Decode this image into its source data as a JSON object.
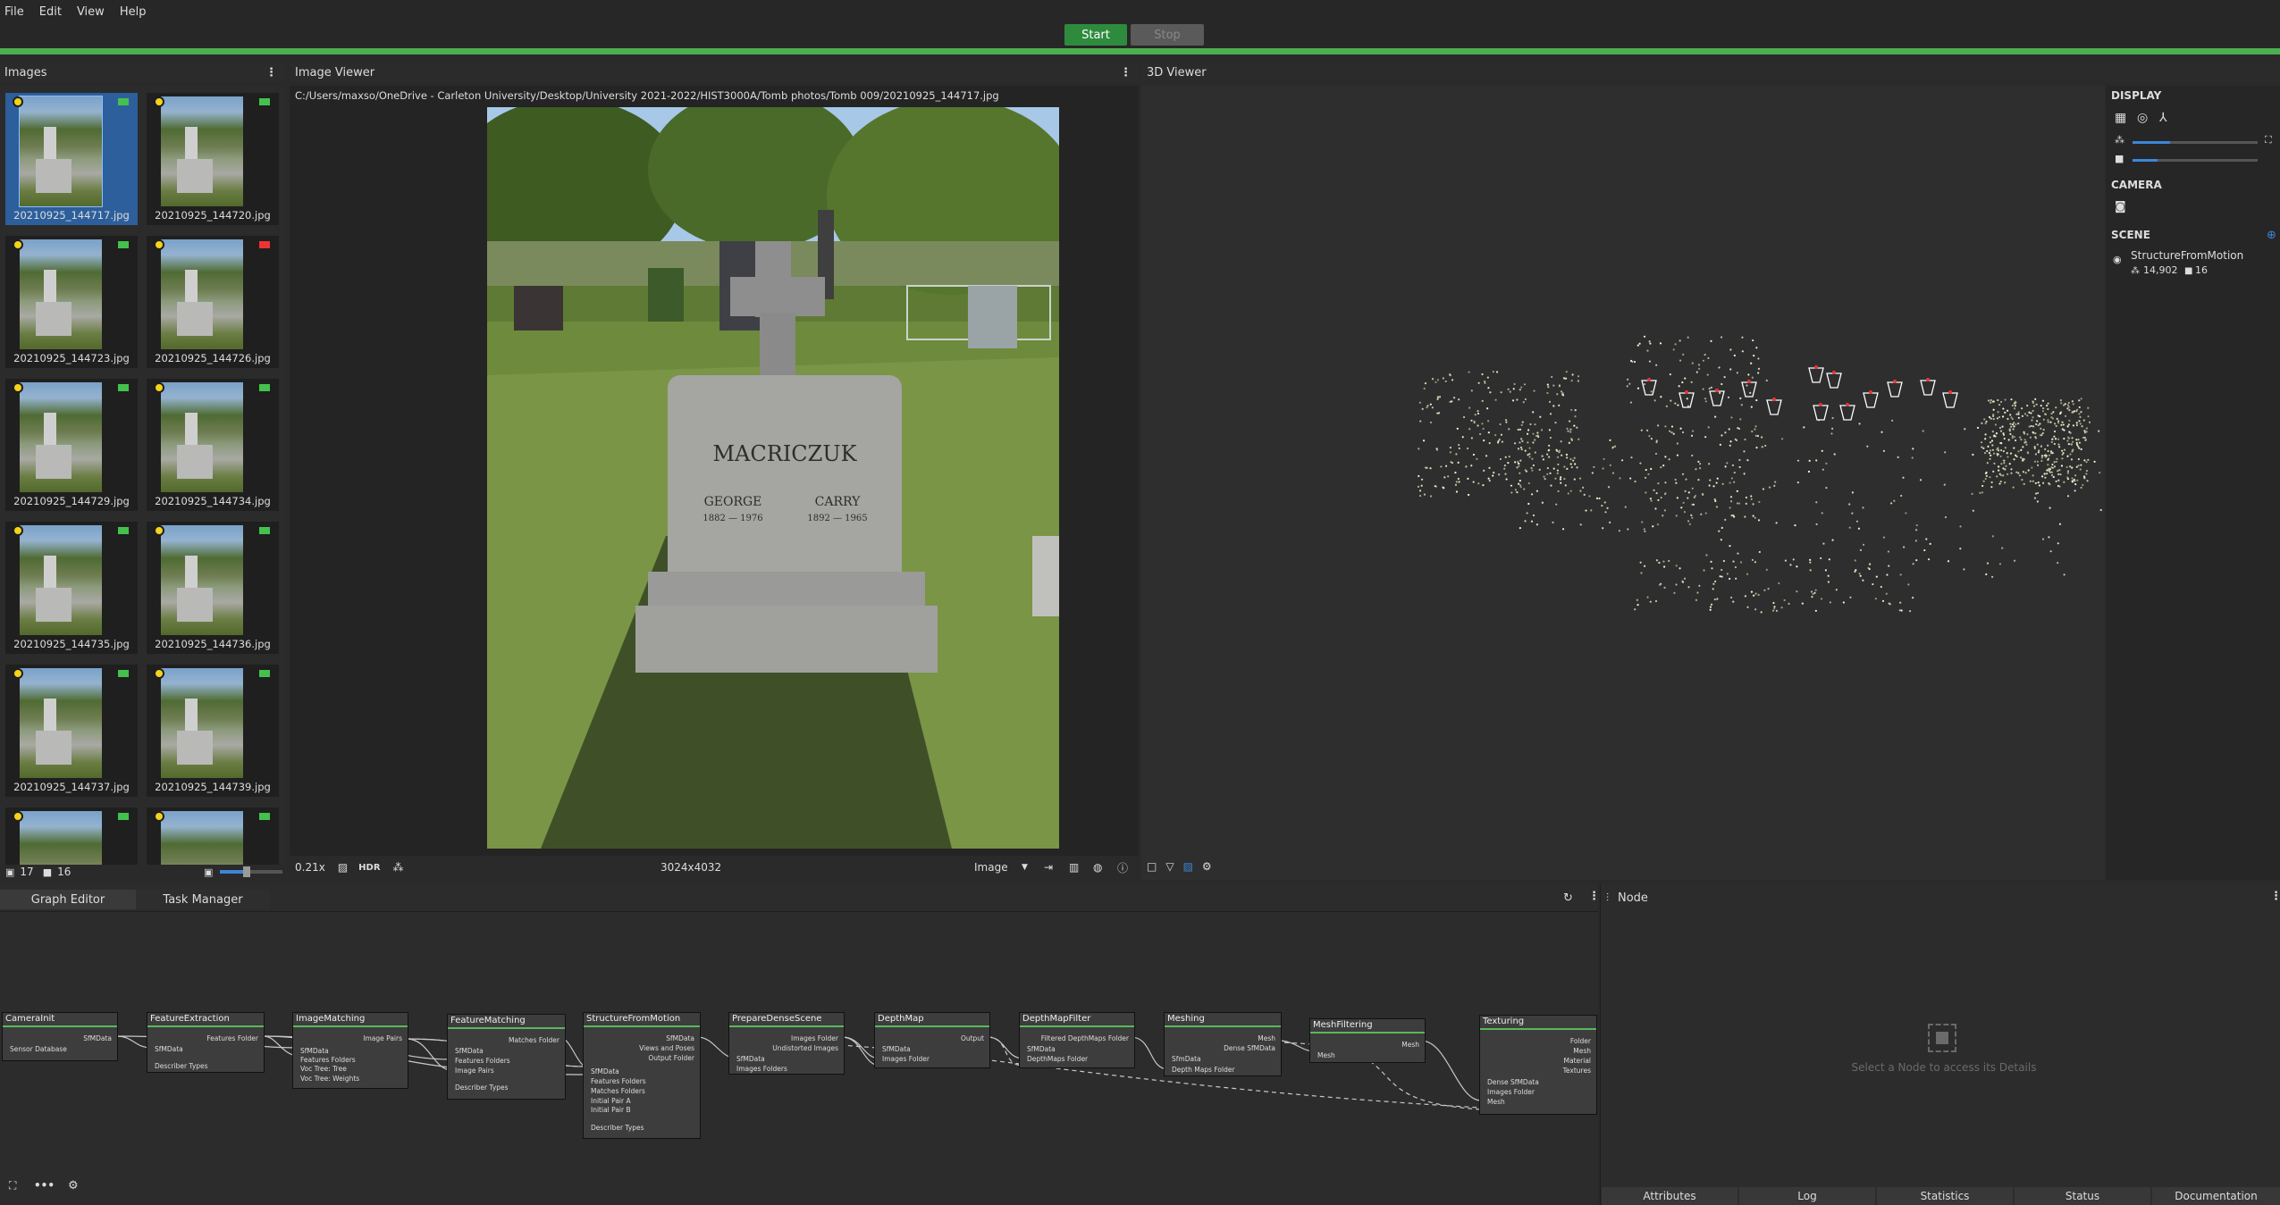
{
  "menu": {
    "file": "File",
    "edit": "Edit",
    "view": "View",
    "help": "Help"
  },
  "toolbar": {
    "start": "Start",
    "stop": "Stop"
  },
  "images_panel": {
    "title": "Images",
    "thumbs": [
      {
        "label": "20210925_144717.jpg"
      },
      {
        "label": "20210925_144720.jpg"
      },
      {
        "label": "20210925_144723.jpg"
      },
      {
        "label": "20210925_144726.jpg"
      },
      {
        "label": "20210925_144729.jpg"
      },
      {
        "label": "20210925_144734.jpg"
      },
      {
        "label": "20210925_144735.jpg"
      },
      {
        "label": "20210925_144736.jpg"
      },
      {
        "label": "20210925_144737.jpg"
      },
      {
        "label": "20210925_144739.jpg"
      },
      {
        "label": ""
      },
      {
        "label": ""
      }
    ],
    "image_count": "17",
    "camera_count": "16"
  },
  "image_viewer": {
    "title": "Image Viewer",
    "path": "C:/Users/maxso/OneDrive - Carleton University/Desktop/University 2021-2022/HIST3000A/Tomb photos/Tomb 009/20210925_144717.jpg",
    "zoom": "0.21x",
    "hdr": "HDR",
    "resolution": "3024x4032",
    "mode": "Image",
    "tomb_text": "MACRICZUK",
    "name_left": "GEORGE",
    "years_left": "1882 — 1976",
    "name_right": "CARRY",
    "years_right": "1892 — 1965"
  },
  "viewer3d": {
    "title": "3D Viewer",
    "display": "DISPLAY",
    "camera": "CAMERA",
    "scene": "SCENE",
    "scene_item": "StructureFromMotion",
    "points": "14,902",
    "cameras": "16"
  },
  "graph": {
    "tab_graph": "Graph Editor",
    "tab_tasks": "Task Manager",
    "node_panel_title": "Node",
    "node_hint": "Select a Node to access its Details",
    "nodes": {
      "camerainit": {
        "title": "CameraInit",
        "o1": "SfMData",
        "i1": "Sensor Database"
      },
      "featureextraction": {
        "title": "FeatureExtraction",
        "o1": "Features Folder",
        "i1": "SfMData",
        "i2": "Describer Types"
      },
      "imagematching": {
        "title": "ImageMatching",
        "o1": "Image Pairs",
        "i1": "SfMData",
        "i2": "Features Folders",
        "i3": "Voc Tree: Tree",
        "i4": "Voc Tree: Weights"
      },
      "featurematching": {
        "title": "FeatureMatching",
        "o1": "Matches Folder",
        "i1": "SfMData",
        "i2": "Features Folders",
        "i3": "Image Pairs",
        "i4": "Describer Types"
      },
      "sfm": {
        "title": "StructureFromMotion",
        "o1": "SfMData",
        "o2": "Views and Poses",
        "o3": "Output Folder",
        "i1": "SfMData",
        "i2": "Features Folders",
        "i3": "Matches Folders",
        "i4": "Initial Pair A",
        "i5": "Initial Pair B",
        "i6": "Describer Types"
      },
      "preparedense": {
        "title": "PrepareDenseScene",
        "o1": "Images Folder",
        "o2": "Undistorted Images",
        "i1": "SfMData",
        "i2": "Images Folders"
      },
      "depthmap": {
        "title": "DepthMap",
        "o1": "Output",
        "i1": "SfMData",
        "i2": "Images Folder"
      },
      "depthmapfilter": {
        "title": "DepthMapFilter",
        "o1": "Filtered DepthMaps Folder",
        "i1": "SfMData",
        "i2": "DepthMaps Folder"
      },
      "meshing": {
        "title": "Meshing",
        "o1": "Mesh",
        "o2": "Dense SfMData",
        "i1": "SfmData",
        "i2": "Depth Maps Folder"
      },
      "meshfiltering": {
        "title": "MeshFiltering",
        "o1": "Mesh",
        "i1": "Mesh"
      },
      "texturing": {
        "title": "Texturing",
        "o1": "Folder",
        "o2": "Mesh",
        "o3": "Material",
        "o4": "Textures",
        "i1": "Dense SfMData",
        "i2": "Images Folder",
        "i3": "Mesh"
      }
    }
  },
  "bottom_tabs": {
    "attributes": "Attributes",
    "log": "Log",
    "statistics": "Statistics",
    "status": "Status",
    "documentation": "Documentation"
  },
  "colors": {
    "accent_green": "#4cae4f",
    "selection_blue": "#2d5f9c",
    "start_button": "#2e8b3e"
  }
}
